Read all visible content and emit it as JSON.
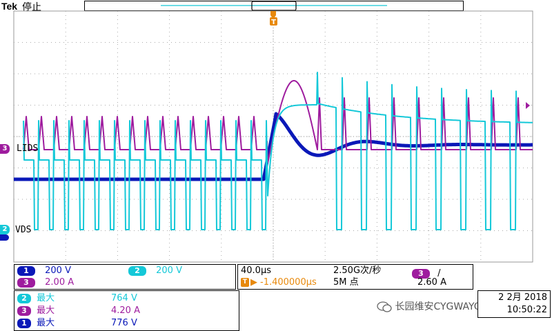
{
  "header": {
    "brand": "Tek",
    "status": "停止"
  },
  "trigger_marker": "T",
  "channel_markers": {
    "ch3": {
      "number": "3",
      "label": "LIDS"
    },
    "ch2": {
      "number": "2",
      "label": "VDS"
    }
  },
  "channels": [
    {
      "number": "1",
      "scale": "200 V"
    },
    {
      "number": "2",
      "scale": "200 V"
    },
    {
      "number": "3",
      "scale": "2.00 A"
    }
  ],
  "timebase": {
    "time_div": "40.0µs",
    "sample_rate": "2.50G次/秒",
    "trigger_position_prefix": "▶",
    "trigger_position": "-1.400000µs",
    "record_length": "5M 点",
    "trigger_source": "3",
    "trigger_slope": "/",
    "trigger_level": "2.60 A"
  },
  "measurements": [
    {
      "channel": "2",
      "name": "最大",
      "value": "764 V"
    },
    {
      "channel": "3",
      "name": "最大",
      "value": "4.20 A"
    },
    {
      "channel": "1",
      "name": "最大",
      "value": "776 V"
    }
  ],
  "datetime": {
    "date": "2 2月 2018",
    "time": "10:50:22"
  },
  "watermark": "长园维安CYGWAYON",
  "colors": {
    "ch1": "#0a18b8",
    "ch2": "#14c8d8",
    "ch3": "#9e1c9e",
    "trigger": "#e8890c"
  }
}
